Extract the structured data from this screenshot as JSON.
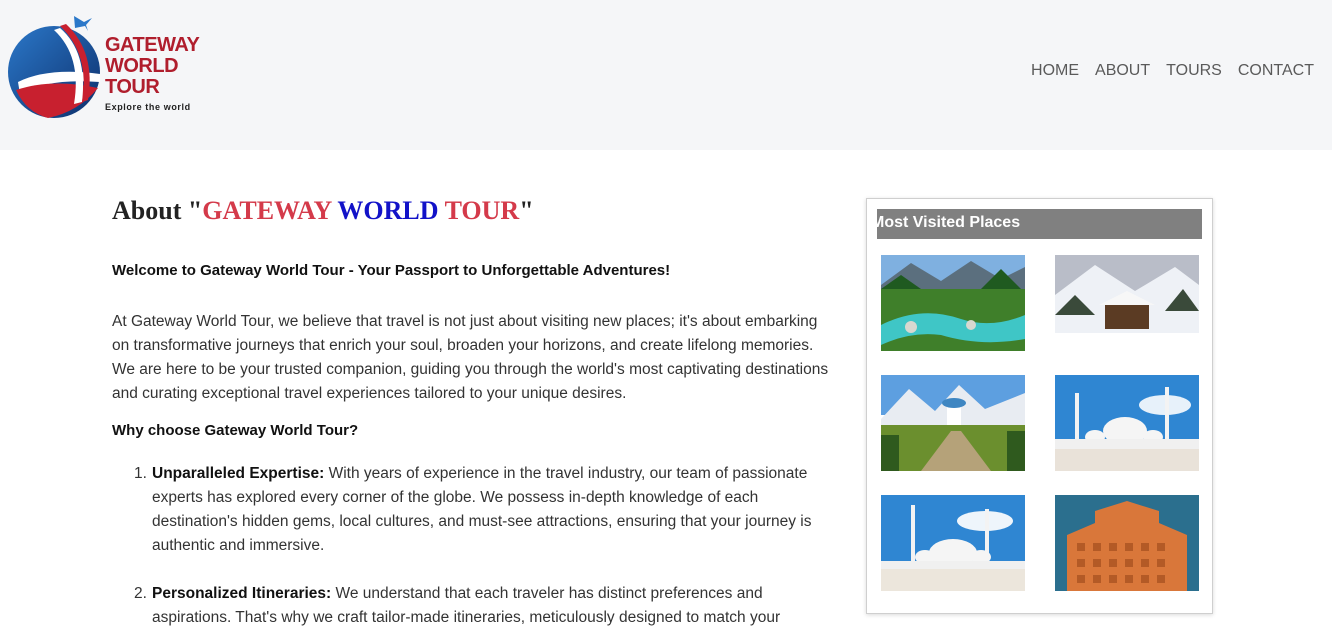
{
  "brand": {
    "line1": "GATEWAY",
    "line2": "WORLD",
    "line3": "TOUR",
    "tagline": "Explore the world",
    "colors": {
      "red": "#b01e2d",
      "blue": "#1a4f9c"
    }
  },
  "nav": {
    "items": [
      {
        "label": "HOME"
      },
      {
        "label": "ABOUT"
      },
      {
        "label": "TOURS"
      },
      {
        "label": "CONTACT"
      }
    ]
  },
  "about": {
    "title_prefix": "About \"",
    "title_w1": "GATEWAY",
    "title_w2": "WORLD",
    "title_w3": "TOUR",
    "title_suffix": "\"",
    "welcome": "Welcome to Gateway World Tour - Your Passport to Unforgettable Adventures!",
    "intro": "At Gateway World Tour, we believe that travel is not just about visiting new places; it's about embarking on transformative journeys that enrich your soul, broaden your horizons, and create lifelong memories. We are here to be your trusted companion, guiding you through the world's most captivating destinations and curating exceptional travel experiences tailored to your unique desires.",
    "why_heading": "Why choose Gateway World Tour?",
    "reasons": [
      {
        "num": "1.",
        "title": "Unparalleled Expertise:",
        "text": " With years of experience in the travel industry, our team of passionate experts has explored every corner of the globe. We possess in-depth knowledge of each destination's hidden gems, local cultures, and must-see attractions, ensuring that your journey is authentic and immersive."
      },
      {
        "num": "2.",
        "title": "Personalized Itineraries:",
        "text": " We understand that each traveler has distinct preferences and aspirations. That's why we craft tailor-made itineraries, meticulously designed to match your"
      }
    ]
  },
  "sidebar": {
    "heading": "Most Visited Places",
    "accent": "#808080",
    "photos": [
      {
        "name": "river-valley-photo"
      },
      {
        "name": "snow-cabin-photo"
      },
      {
        "name": "mountain-garden-photo"
      },
      {
        "name": "white-mosque-photo"
      },
      {
        "name": "white-mosque-courtyard-photo"
      },
      {
        "name": "pink-palace-photo"
      }
    ]
  }
}
